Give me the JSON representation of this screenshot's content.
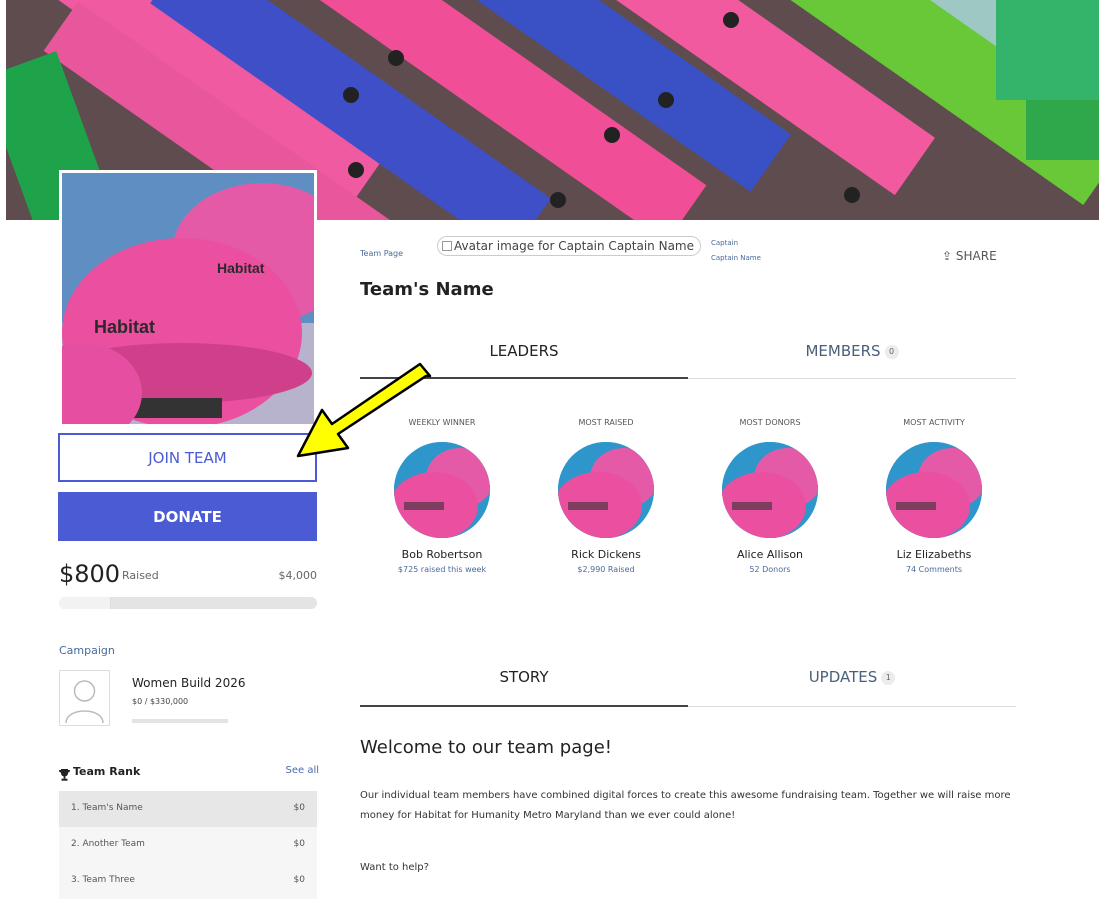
{
  "left": {
    "join_label": "JOIN TEAM",
    "donate_label": "DONATE",
    "raised_amount": "$800",
    "raised_label": "Raised",
    "goal": "$4,000",
    "progress_fraction": 0.2,
    "campaign_label": "Campaign",
    "campaign": {
      "name": "Women Build 2026",
      "amount": "$0 / $330,000"
    },
    "rank": {
      "title": "Team Rank",
      "see_all": "See all",
      "rows": [
        {
          "name": "1. Team's Name",
          "amount": "$0"
        },
        {
          "name": "2. Another Team",
          "amount": "$0"
        },
        {
          "name": "3. Team Three",
          "amount": "$0"
        }
      ]
    }
  },
  "header": {
    "team_page": "Team Page",
    "captain_avatar_alt": "Avatar image for Captain Captain Name",
    "captain_label": "Captain",
    "captain_name": "Captain Name",
    "share_label": "SHARE",
    "team_name": "Team's Name"
  },
  "tabs_top": {
    "leaders": "LEADERS",
    "members": "MEMBERS",
    "members_count": "0"
  },
  "leaders": [
    {
      "category": "WEEKLY WINNER",
      "name": "Bob Robertson",
      "stat": "$725 raised this week"
    },
    {
      "category": "MOST RAISED",
      "name": "Rick Dickens",
      "stat": "$2,990 Raised"
    },
    {
      "category": "MOST DONORS",
      "name": "Alice Allison",
      "stat": "52 Donors"
    },
    {
      "category": "MOST ACTIVITY",
      "name": "Liz Elizabeths",
      "stat": "74 Comments"
    }
  ],
  "tabs_bottom": {
    "story": "STORY",
    "updates": "UPDATES",
    "updates_count": "1"
  },
  "story": {
    "title": "Welcome to our team page!",
    "body": "Our individual team members have combined digital forces to create this awesome fundraising team. Together we will raise more money for Habitat for Humanity Metro Maryland than we ever could alone!",
    "help": "Want to help?"
  },
  "colors": {
    "accent": "#4a5bd4",
    "arrow": "#ffff00",
    "hardhat": "#e8489a"
  }
}
